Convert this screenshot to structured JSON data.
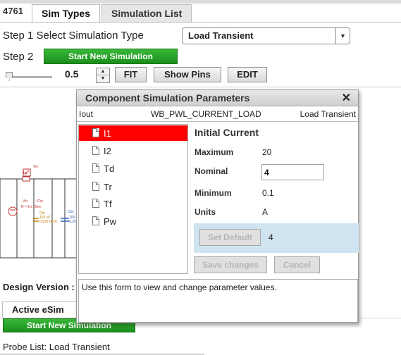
{
  "app": {
    "id": "4761"
  },
  "tabs": [
    {
      "label": "Sim Types",
      "active": true
    },
    {
      "label": "Simulation List",
      "active": false
    }
  ],
  "step1": {
    "label": "Step 1  Select Simulation Type",
    "selected": "Load Transient"
  },
  "step2": {
    "label": "Step 2",
    "start_button": "Start New Simulation"
  },
  "toolbar": {
    "zoom": "0.5",
    "fit": "FIT",
    "show_pins": "Show Pins",
    "edit": "EDIT"
  },
  "schematic_labels": {
    "vin": "Vin",
    "iin": "Iin",
    "vin_src": "Vin",
    "civin": "ICin",
    "rs": "R = 1m Ohm",
    "cin": "Cin",
    "cin_val": "120 uF",
    "cin_esr": "0.025 Ohm",
    "cby": "Cby",
    "cby_val": "100",
    "cby_esr": "0.25"
  },
  "dialog": {
    "title": "Component Simulation Parameters",
    "header": {
      "component": "Iout",
      "model": "WB_PWL_CURRENT_LOAD",
      "sim_type": "Load Transient"
    },
    "params": [
      "I1",
      "I2",
      "Td",
      "Tr",
      "Tf",
      "Pw"
    ],
    "selected_param": "I1",
    "detail": {
      "title": "Initial Current",
      "maximum_label": "Maximum",
      "maximum": "20",
      "nominal_label": "Nominal",
      "nominal": "4",
      "minimum_label": "Minimum",
      "minimum": "0.1",
      "units_label": "Units",
      "units": "A"
    },
    "set_default": "Set Default",
    "default_value": "4",
    "save": "Save changes",
    "cancel": "Cancel",
    "help": "Use this form to view and change parameter values."
  },
  "design_version": {
    "label": "Design Version :"
  },
  "esim": {
    "tab": "Active eSim",
    "start_button": "Start New Simulation"
  },
  "probe_list": "Probe List: Load Transient",
  "colors": {
    "green": "#1f9f1f",
    "selected": "#ff0000",
    "default_box": "#cfe3f1"
  }
}
